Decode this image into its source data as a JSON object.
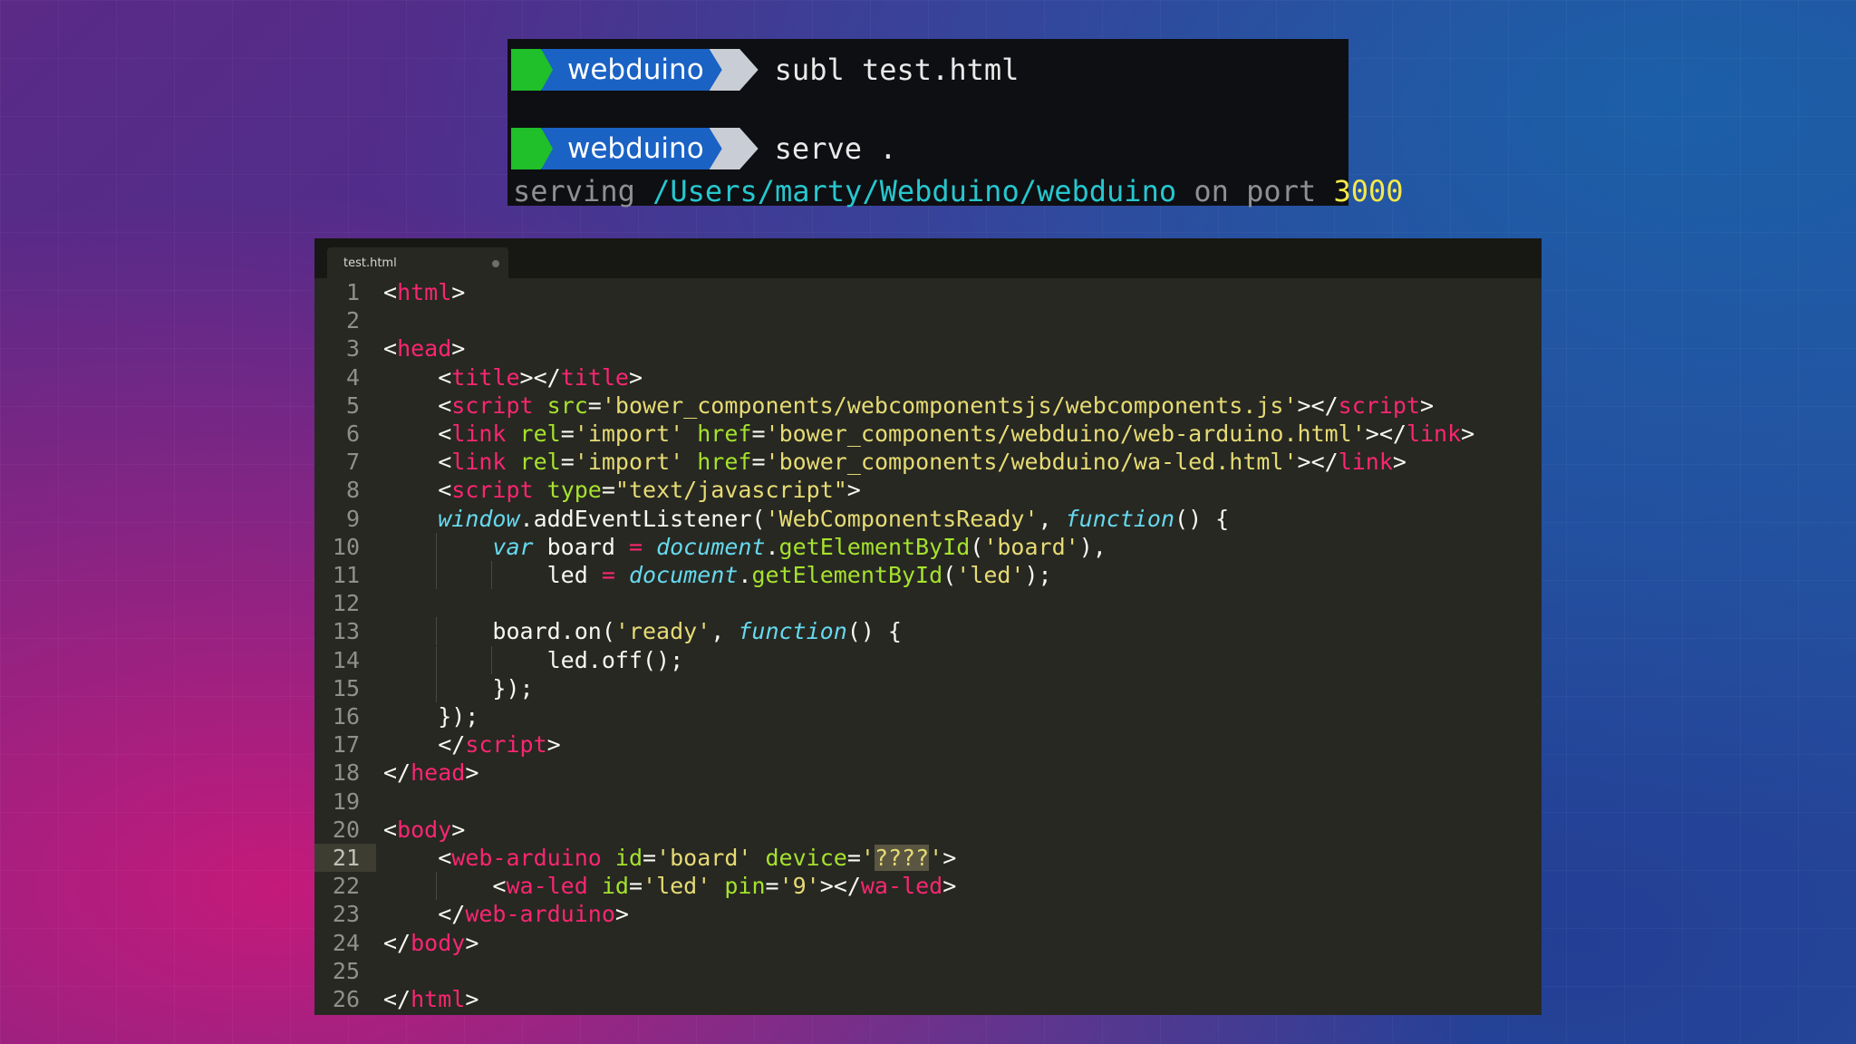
{
  "terminal": {
    "prompt_dir": "webduino",
    "cmd1": "subl test.html",
    "cmd2": "serve .",
    "output": {
      "prefix": "serving ",
      "path": "/Users/marty/Webduino/webduino",
      "mid": " on port ",
      "port": "3000"
    }
  },
  "editor": {
    "tab_label": "test.html",
    "active_line": 21,
    "line_numbers": [
      "1",
      "2",
      "3",
      "4",
      "5",
      "6",
      "7",
      "8",
      "9",
      "10",
      "11",
      "12",
      "13",
      "14",
      "15",
      "16",
      "17",
      "18",
      "19",
      "20",
      "21",
      "22",
      "23",
      "24",
      "25",
      "26"
    ],
    "lines": [
      [
        [
          "p",
          "<"
        ],
        [
          "k",
          "html"
        ],
        [
          "p",
          ">"
        ]
      ],
      [],
      [
        [
          "p",
          "<"
        ],
        [
          "k",
          "head"
        ],
        [
          "p",
          ">"
        ]
      ],
      [
        [
          "p",
          "    <"
        ],
        [
          "k",
          "title"
        ],
        [
          "p",
          "></"
        ],
        [
          "k",
          "title"
        ],
        [
          "p",
          ">"
        ]
      ],
      [
        [
          "p",
          "    <"
        ],
        [
          "k",
          "script"
        ],
        [
          "p",
          " "
        ],
        [
          "a",
          "src"
        ],
        [
          "p",
          "="
        ],
        [
          "s",
          "'bower_components/webcomponentsjs/webcomponents.js'"
        ],
        [
          "p",
          "></"
        ],
        [
          "k",
          "script"
        ],
        [
          "p",
          ">"
        ]
      ],
      [
        [
          "p",
          "    <"
        ],
        [
          "k",
          "link"
        ],
        [
          "p",
          " "
        ],
        [
          "a",
          "rel"
        ],
        [
          "p",
          "="
        ],
        [
          "s",
          "'import'"
        ],
        [
          "p",
          " "
        ],
        [
          "a",
          "href"
        ],
        [
          "p",
          "="
        ],
        [
          "s",
          "'bower_components/webduino/web-arduino.html'"
        ],
        [
          "p",
          "></"
        ],
        [
          "k",
          "link"
        ],
        [
          "p",
          ">"
        ]
      ],
      [
        [
          "p",
          "    <"
        ],
        [
          "k",
          "link"
        ],
        [
          "p",
          " "
        ],
        [
          "a",
          "rel"
        ],
        [
          "p",
          "="
        ],
        [
          "s",
          "'import'"
        ],
        [
          "p",
          " "
        ],
        [
          "a",
          "href"
        ],
        [
          "p",
          "="
        ],
        [
          "s",
          "'bower_components/webduino/wa-led.html'"
        ],
        [
          "p",
          "></"
        ],
        [
          "k",
          "link"
        ],
        [
          "p",
          ">"
        ]
      ],
      [
        [
          "p",
          "    <"
        ],
        [
          "k",
          "script"
        ],
        [
          "p",
          " "
        ],
        [
          "a",
          "type"
        ],
        [
          "p",
          "="
        ],
        [
          "s",
          "\"text/javascript\""
        ],
        [
          "p",
          ">"
        ]
      ],
      [
        [
          "p",
          "    "
        ],
        [
          "f",
          "window"
        ],
        [
          "p",
          ".addEventListener("
        ],
        [
          "s",
          "'WebComponentsReady'"
        ],
        [
          "p",
          ", "
        ],
        [
          "f",
          "function"
        ],
        [
          "p",
          "() {"
        ]
      ],
      [
        [
          "p",
          "        "
        ],
        [
          "f",
          "var"
        ],
        [
          "p",
          " board "
        ],
        [
          "k",
          "="
        ],
        [
          "p",
          " "
        ],
        [
          "f",
          "document"
        ],
        [
          "p",
          "."
        ],
        [
          "a",
          "getElementById"
        ],
        [
          "p",
          "("
        ],
        [
          "s",
          "'board'"
        ],
        [
          "p",
          "),"
        ]
      ],
      [
        [
          "p",
          "            led "
        ],
        [
          "k",
          "="
        ],
        [
          "p",
          " "
        ],
        [
          "f",
          "document"
        ],
        [
          "p",
          "."
        ],
        [
          "a",
          "getElementById"
        ],
        [
          "p",
          "("
        ],
        [
          "s",
          "'led'"
        ],
        [
          "p",
          ");"
        ]
      ],
      [],
      [
        [
          "p",
          "        board.on("
        ],
        [
          "s",
          "'ready'"
        ],
        [
          "p",
          ", "
        ],
        [
          "f",
          "function"
        ],
        [
          "p",
          "() {"
        ]
      ],
      [
        [
          "p",
          "            led.off();"
        ]
      ],
      [
        [
          "p",
          "        });"
        ]
      ],
      [
        [
          "p",
          "    });"
        ]
      ],
      [
        [
          "p",
          "    </"
        ],
        [
          "k",
          "script"
        ],
        [
          "p",
          ">"
        ]
      ],
      [
        [
          "p",
          "</"
        ],
        [
          "k",
          "head"
        ],
        [
          "p",
          ">"
        ]
      ],
      [],
      [
        [
          "p",
          "<"
        ],
        [
          "k",
          "body"
        ],
        [
          "p",
          ">"
        ]
      ],
      [
        [
          "p",
          "    <"
        ],
        [
          "k",
          "web-arduino"
        ],
        [
          "p",
          " "
        ],
        [
          "a",
          "id"
        ],
        [
          "p",
          "="
        ],
        [
          "s",
          "'board'"
        ],
        [
          "p",
          " "
        ],
        [
          "a",
          "device"
        ],
        [
          "p",
          "="
        ],
        [
          "s",
          "'"
        ],
        [
          "h",
          "????"
        ],
        [
          "s",
          "'"
        ],
        [
          "p",
          ">"
        ]
      ],
      [
        [
          "p",
          "        <"
        ],
        [
          "k",
          "wa-led"
        ],
        [
          "p",
          " "
        ],
        [
          "a",
          "id"
        ],
        [
          "p",
          "="
        ],
        [
          "s",
          "'led'"
        ],
        [
          "p",
          " "
        ],
        [
          "a",
          "pin"
        ],
        [
          "p",
          "="
        ],
        [
          "s",
          "'9'"
        ],
        [
          "p",
          "></"
        ],
        [
          "k",
          "wa-led"
        ],
        [
          "p",
          ">"
        ]
      ],
      [
        [
          "p",
          "    </"
        ],
        [
          "k",
          "web-arduino"
        ],
        [
          "p",
          ">"
        ]
      ],
      [
        [
          "p",
          "</"
        ],
        [
          "k",
          "body"
        ],
        [
          "p",
          ">"
        ]
      ],
      [],
      [
        [
          "p",
          "</"
        ],
        [
          "k",
          "html"
        ],
        [
          "p",
          ">"
        ]
      ]
    ]
  }
}
